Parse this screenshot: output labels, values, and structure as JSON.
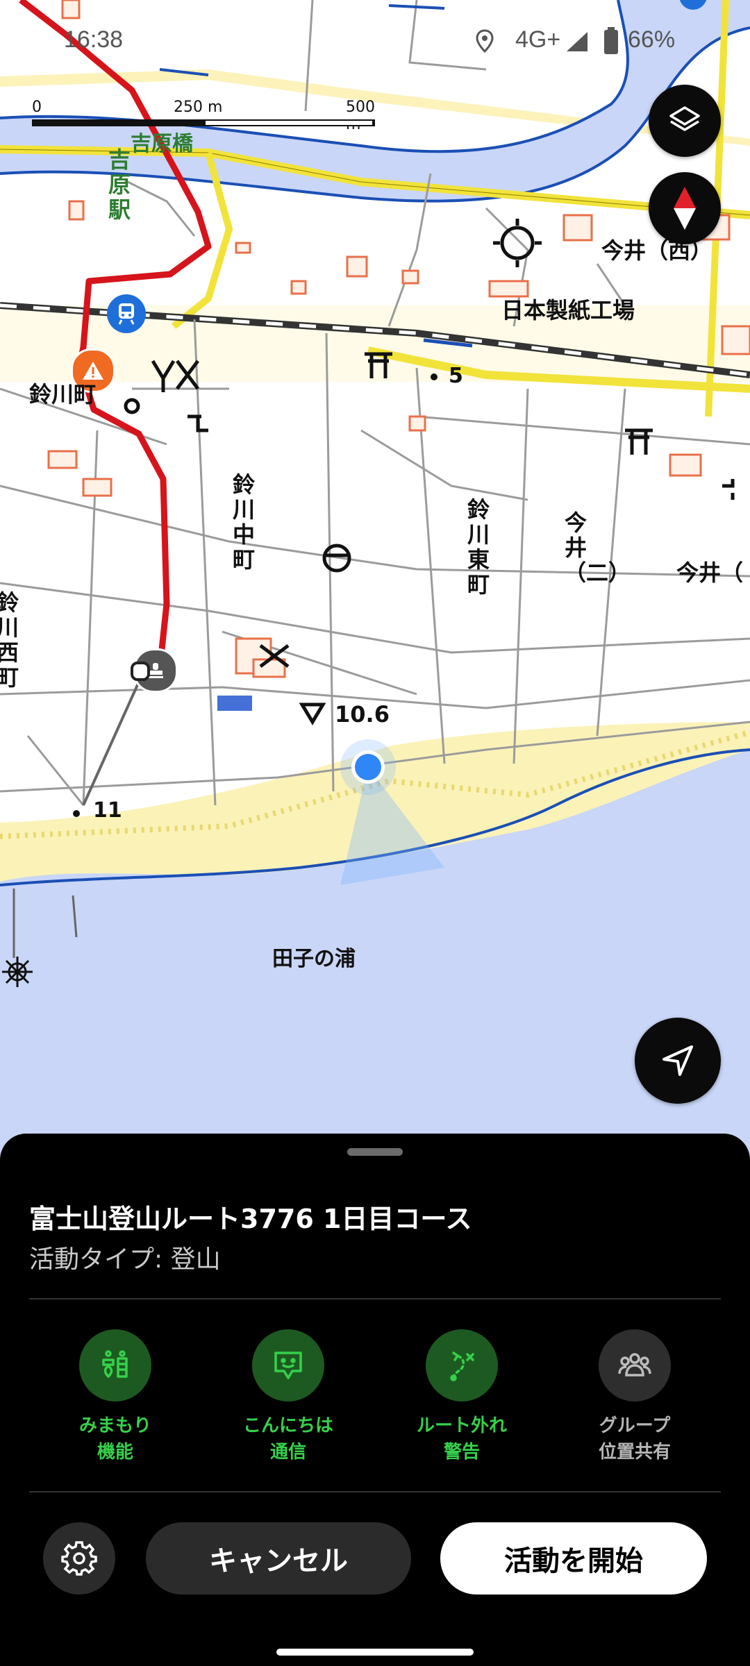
{
  "status_bar": {
    "time": "16:38",
    "network": "4G+",
    "battery": "66%"
  },
  "scale_bar": {
    "ticks": [
      "0",
      "250 m",
      "500 m"
    ]
  },
  "map": {
    "labels": {
      "yoshiwara_bridge": "吉原橋",
      "yoshiwara_station": "吉原駅",
      "imai_nishi": "今井（西）",
      "nihon_seishi": "日本製紙工場",
      "suzukawa_cho": "鈴川町",
      "route_5": "5",
      "suzukawa_nakamachi": "鈴川中町",
      "suzukawa_higashimachi": "鈴川東町",
      "imai_ni": "今井（二）",
      "imai_right": "今井（",
      "suzukawa_nishimachi": "鈴川西町",
      "elevation": "10.6",
      "route_11": "11",
      "tagonoura": "田子の浦"
    }
  },
  "sheet": {
    "title": "富士山登山ルート3776 1日目コース",
    "activity_type": "活動タイプ: 登山",
    "features": [
      {
        "label_line1": "みまもり",
        "label_line2": "機能",
        "icon": "guardian-icon"
      },
      {
        "label_line1": "こんにちは",
        "label_line2": "通信",
        "icon": "greeting-icon"
      },
      {
        "label_line1": "ルート外れ",
        "label_line2": "警告",
        "icon": "off-route-icon"
      },
      {
        "label_line1": "グループ",
        "label_line2": "位置共有",
        "icon": "group-icon"
      }
    ],
    "cancel_label": "キャンセル",
    "start_label": "活動を開始"
  },
  "colors": {
    "route": "#d6141b",
    "sea": "#c9d6f7",
    "accent_green": "#35d14a",
    "road_yellow": "#f2e33a"
  }
}
